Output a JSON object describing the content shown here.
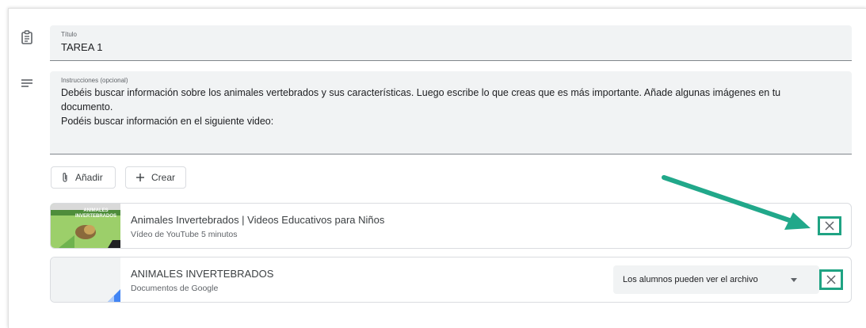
{
  "title_field": {
    "label": "Título",
    "value": "TAREA 1"
  },
  "instructions_field": {
    "label": "Instrucciones (opcional)",
    "lines": [
      "Debéis buscar información sobre los animales vertebrados y sus características. Luego escribe lo que creas que es más importante. Añade algunas imágenes en tu",
      "documento.",
      "Podéis buscar información en el siguiente video:"
    ]
  },
  "buttons": {
    "add_label": "Añadir",
    "create_label": "Crear"
  },
  "attachments": [
    {
      "title": "Animales Invertebrados | Videos Educativos para Niños",
      "subtitle": "Vídeo de YouTube  5 minutos",
      "thumb_text": "ANIMALES INVERTEBRADOS"
    },
    {
      "title": "ANIMALES INVERTEBRADOS",
      "subtitle": "Documentos de Google",
      "permission": "Los alumnos pueden ver el archivo"
    }
  ],
  "colors": {
    "highlight": "#1fa383",
    "field_bg": "#f1f3f4",
    "arrow": "#21a88a"
  },
  "icons": [
    "assignment-icon",
    "notes-icon",
    "paperclip-icon",
    "plus-icon",
    "close-icon",
    "dropdown-arrow-icon",
    "arrow-annotation"
  ]
}
